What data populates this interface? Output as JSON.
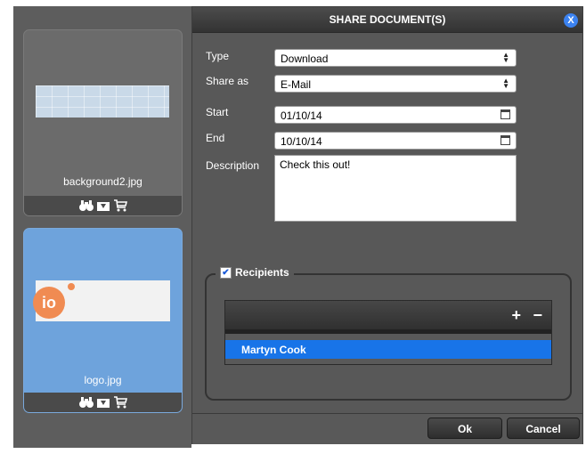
{
  "gallery": {
    "items": [
      {
        "filename": "background2.jpg",
        "selected": false
      },
      {
        "filename": "logo.jpg",
        "selected": true,
        "logo_text": "io"
      }
    ]
  },
  "dialog": {
    "title": "SHARE DOCUMENT(S)",
    "close_glyph": "X",
    "fields": {
      "type_label": "Type",
      "type_value": "Download",
      "share_as_label": "Share as",
      "share_as_value": "E-Mail",
      "start_label": "Start",
      "start_value": "01/10/14",
      "end_label": "End",
      "end_value": "10/10/14",
      "description_label": "Description",
      "description_value": "Check this out!"
    },
    "recipients": {
      "label": "Recipients",
      "checked": true,
      "add_glyph": "+",
      "remove_glyph": "−",
      "rows": [
        "Martyn Cook"
      ]
    },
    "buttons": {
      "ok": "Ok",
      "cancel": "Cancel"
    }
  },
  "colors": {
    "accent_blue": "#1874e8",
    "dialog_bg": "#585858",
    "selected_thumb": "#6ea3dc"
  }
}
